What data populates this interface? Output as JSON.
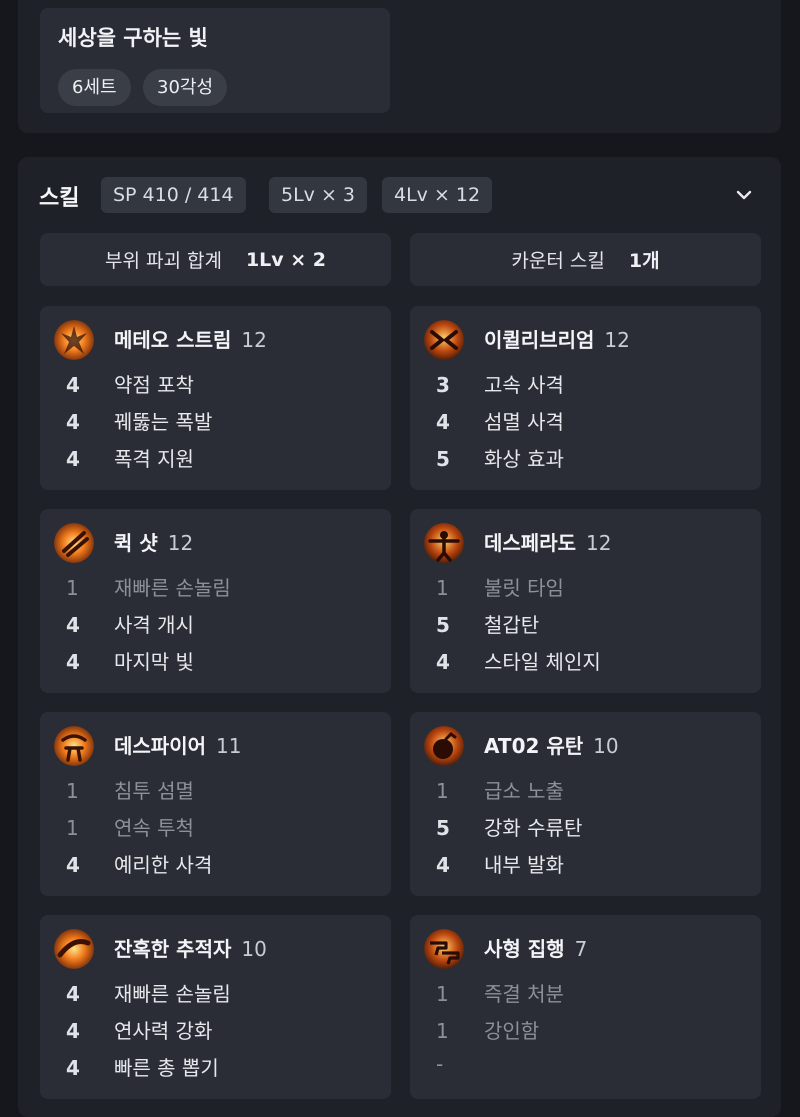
{
  "set_effect": {
    "name": "세상을 구하는 빛",
    "tags": [
      "6세트",
      "30각성"
    ]
  },
  "skills_section": {
    "title": "스킬",
    "sp": "SP 410 / 414",
    "level_counts": [
      "5Lv × 3",
      "4Lv × 12"
    ],
    "expand_icon": "chevron-down-icon",
    "destruction": {
      "label": "부위 파괴 합계",
      "value": "1Lv × 2"
    },
    "counter": {
      "label": "카운터 스킬",
      "value": "1개"
    }
  },
  "skills": [
    {
      "name": "메테오 스트림",
      "level": "12",
      "icon": "meteor-stream-icon",
      "tripods": [
        {
          "lv": "4",
          "name": "약점 포착"
        },
        {
          "lv": "4",
          "name": "꿰뚫는 폭발"
        },
        {
          "lv": "4",
          "name": "폭격 지원"
        }
      ]
    },
    {
      "name": "이퀼리브리엄",
      "level": "12",
      "icon": "equilibrium-icon",
      "tripods": [
        {
          "lv": "3",
          "name": "고속 사격"
        },
        {
          "lv": "4",
          "name": "섬멸 사격"
        },
        {
          "lv": "5",
          "name": "화상 효과"
        }
      ]
    },
    {
      "name": "퀵 샷",
      "level": "12",
      "icon": "quick-shot-icon",
      "tripods": [
        {
          "lv": "1",
          "name": "재빠른 손놀림"
        },
        {
          "lv": "4",
          "name": "사격 개시"
        },
        {
          "lv": "4",
          "name": "마지막 빛"
        }
      ]
    },
    {
      "name": "데스페라도",
      "level": "12",
      "icon": "desperado-icon",
      "tripods": [
        {
          "lv": "1",
          "name": "불릿 타임"
        },
        {
          "lv": "5",
          "name": "철갑탄"
        },
        {
          "lv": "4",
          "name": "스타일 체인지"
        }
      ]
    },
    {
      "name": "데스파이어",
      "level": "11",
      "icon": "death-fire-icon",
      "tripods": [
        {
          "lv": "1",
          "name": "침투 섬멸"
        },
        {
          "lv": "1",
          "name": "연속 투척"
        },
        {
          "lv": "4",
          "name": "예리한 사격"
        }
      ]
    },
    {
      "name": "AT02 유탄",
      "level": "10",
      "icon": "at02-grenade-icon",
      "tripods": [
        {
          "lv": "1",
          "name": "급소 노출"
        },
        {
          "lv": "5",
          "name": "강화 수류탄"
        },
        {
          "lv": "4",
          "name": "내부 발화"
        }
      ]
    },
    {
      "name": "잔혹한 추적자",
      "level": "10",
      "icon": "cruel-tracker-icon",
      "tripods": [
        {
          "lv": "4",
          "name": "재빠른 손놀림"
        },
        {
          "lv": "4",
          "name": "연사력 강화"
        },
        {
          "lv": "4",
          "name": "빠른 총 뽑기"
        }
      ]
    },
    {
      "name": "사형 집행",
      "level": "7",
      "icon": "execution-icon",
      "tripods": [
        {
          "lv": "1",
          "name": "즉결 처분"
        },
        {
          "lv": "1",
          "name": "강인함"
        },
        {
          "lv": "-",
          "name": ""
        }
      ]
    }
  ]
}
